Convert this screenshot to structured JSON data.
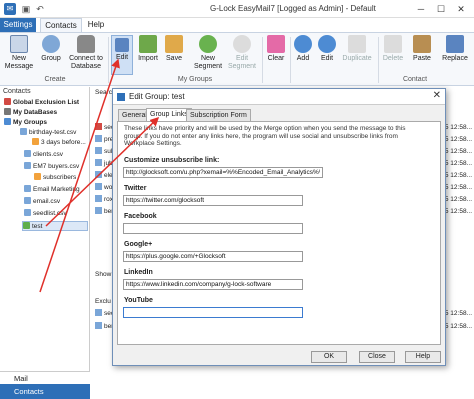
{
  "window": {
    "title": "G-Lock EasyMail7 [Logged as Admin] - Default",
    "minimize": "─",
    "maximize": "☐",
    "close": "✕"
  },
  "ribbon_tabs": [
    "Settings",
    "Contacts",
    "Help"
  ],
  "ribbon": {
    "new_message": "New\nMessage",
    "group": "Group",
    "connect_db": "Connect to\nDatabase",
    "create_label": "Create",
    "edit": "Edit",
    "import": "Import",
    "save": "Save",
    "new_segment": "New\nSegment",
    "edit_segment": "Edit\nSegment",
    "my_groups_label": "My Groups",
    "clear": "Clear",
    "add": "Add",
    "edit2": "Edit",
    "duplicate": "Duplicate",
    "delete": "Delete",
    "paste": "Paste",
    "replace": "Replace",
    "contact_label": "Contact"
  },
  "left_panel": {
    "title": "Contacts",
    "items": [
      "Global Exclusion List",
      "My DataBases",
      "My Groups",
      "birthday-test.csv",
      "3 days before...",
      "clients.csv",
      "EM7 buyers.csv",
      "subscribers",
      "Email Marketing",
      "email.csv",
      "seedlist.csv",
      "test"
    ],
    "nav_mail": "Mail",
    "nav_contacts": "Contacts"
  },
  "background": {
    "search_label": "Searc",
    "list_items": [
      "seo",
      "pre",
      "sul",
      "jub",
      "ele",
      "wol",
      "rox",
      "ber"
    ],
    "dates": [
      "5 12:58...",
      "5 12:58...",
      "5 12:58...",
      "5 12:58...",
      "5 12:58...",
      "5 12:58...",
      "5 12:58...",
      "5 12:58..."
    ],
    "show_label": "Show",
    "exclu_label": "Exclu",
    "exclu_items": [
      "seo",
      "ber"
    ],
    "exclu_dates": [
      "5 12:58...",
      "5 12:58..."
    ]
  },
  "dialog": {
    "title": "Edit Group: test",
    "tabs": [
      "General",
      "Group Links",
      "Subscription Form"
    ],
    "description": "These links have priority and will be used by the Merge option when you send the message to this group. If you do not enter any links here, the program will use social and unsubscribe links from Workplace Settings.",
    "fields": [
      {
        "label": "Customize unsubscribe link:",
        "value": "http://glocksoft.com/u.php?xemail=%%Encoded_Email_Analytics%%"
      },
      {
        "label": "Twitter",
        "value": "https://twitter.com/glocksoft"
      },
      {
        "label": "Facebook",
        "value": ""
      },
      {
        "label": "Google+",
        "value": "https://plus.google.com/+Glocksoft"
      },
      {
        "label": "LinkedIn",
        "value": "https://www.linkedin.com/company/g-lock-software"
      },
      {
        "label": "YouTube",
        "value": ""
      }
    ],
    "ok": "OK",
    "close": "Close",
    "help": "Help"
  },
  "colors": {
    "accent": "#2e6fb7",
    "arrow": "#e0302a"
  }
}
